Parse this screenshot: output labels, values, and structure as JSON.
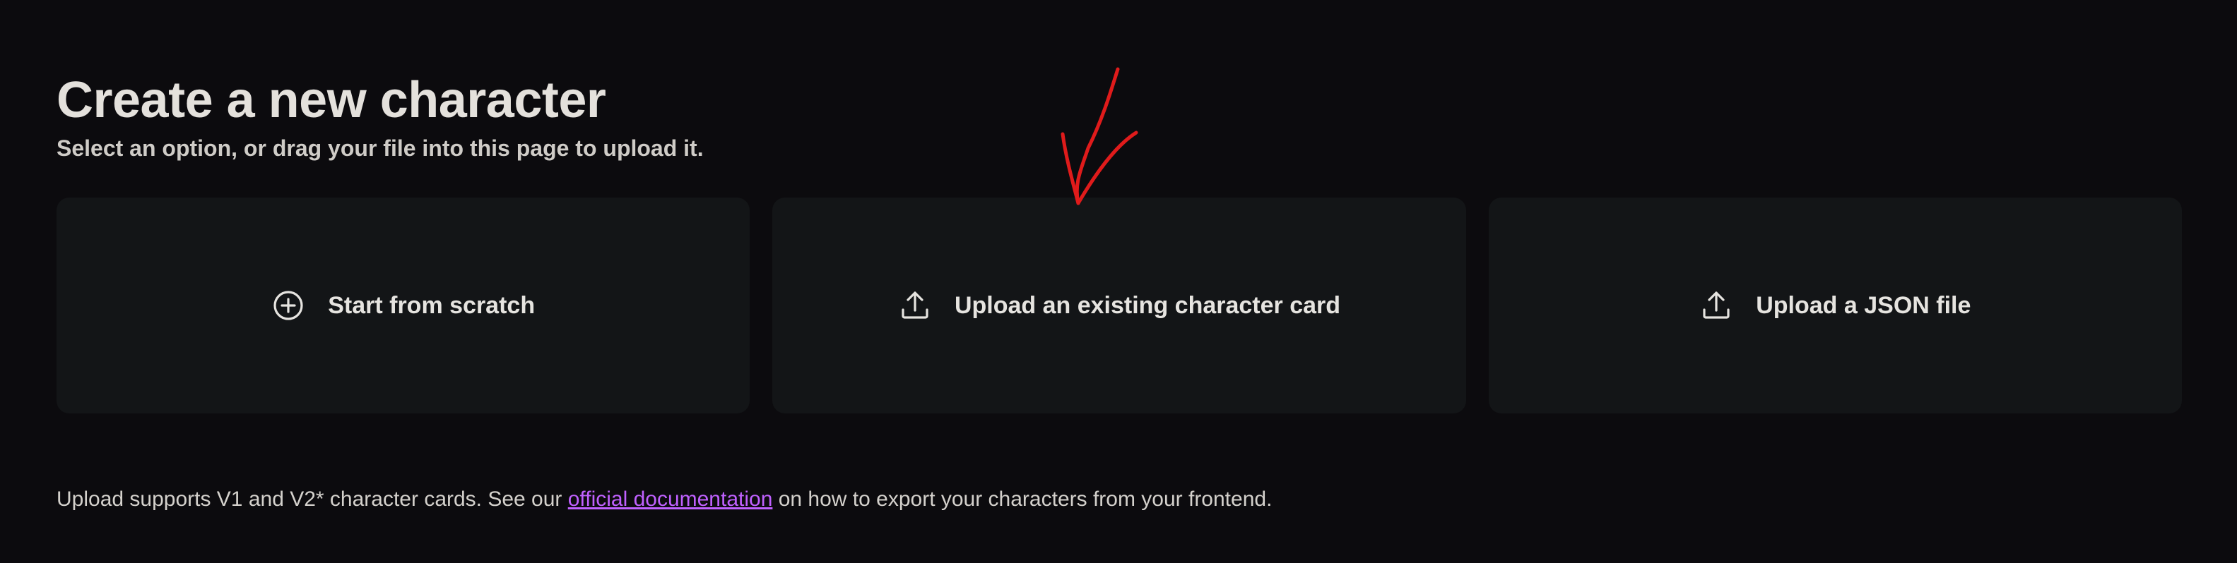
{
  "header": {
    "title": "Create a new character",
    "subtitle": "Select an option, or drag your file into this page to upload it."
  },
  "cards": [
    {
      "label": "Start from scratch",
      "icon": "plus-circle-icon"
    },
    {
      "label": "Upload an existing character card",
      "icon": "upload-icon"
    },
    {
      "label": "Upload a JSON file",
      "icon": "upload-icon"
    }
  ],
  "footer": {
    "text_before": "Upload supports V1 and V2* character cards. See our ",
    "link_text": "official documentation",
    "text_after": " on how to export your characters from your frontend."
  },
  "colors": {
    "background": "#0c0b0e",
    "card": "#131517",
    "link": "#c061ff",
    "annotation": "#e01b1b"
  }
}
